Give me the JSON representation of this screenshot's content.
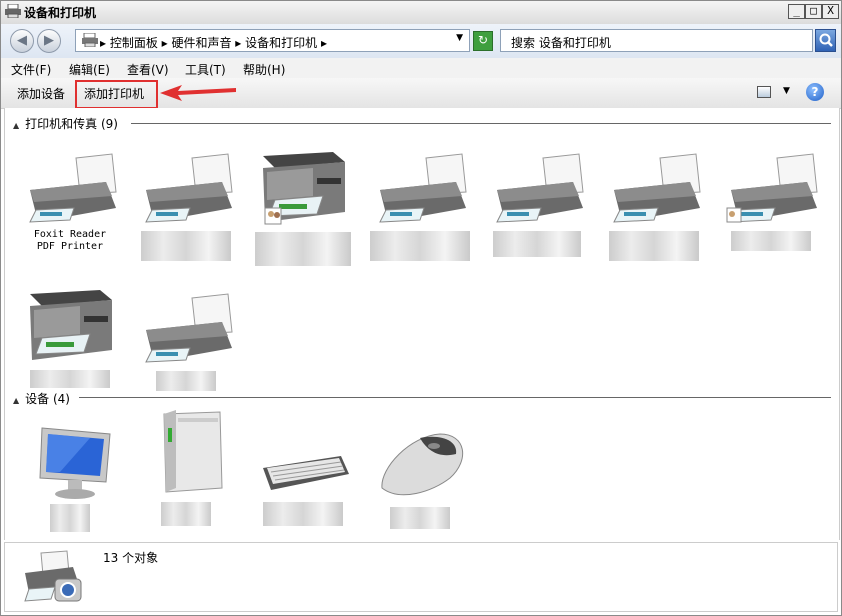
{
  "window": {
    "title": "设备和打印机",
    "minimize": "_",
    "maximize": "□",
    "close": "X"
  },
  "nav": {
    "back_icon": "back-arrow-icon",
    "forward_icon": "forward-arrow-icon"
  },
  "address": {
    "crumbs": [
      "控制面板",
      "硬件和声音",
      "设备和打印机"
    ],
    "text": "▸ 控制面板 ▸ 硬件和声音 ▸ 设备和打印机 ▸"
  },
  "search": {
    "placeholder": "搜索 设备和打印机"
  },
  "menu": {
    "file": "文件(F)",
    "edit": "编辑(E)",
    "view": "查看(V)",
    "tools": "工具(T)",
    "help": "帮助(H)"
  },
  "commands": {
    "add_device": "添加设备",
    "add_printer": "添加打印机"
  },
  "groups": {
    "printers": {
      "title": "打印机和传真 (9)"
    },
    "devices": {
      "title": "设备 (4)"
    }
  },
  "printers": [
    {
      "label1": "Foxit Reader",
      "label2": "PDF Printer",
      "icon": "printer-icon"
    },
    {
      "icon": "printer-icon"
    },
    {
      "icon": "mfp-printer-icon"
    },
    {
      "icon": "printer-icon"
    },
    {
      "icon": "printer-icon"
    },
    {
      "icon": "printer-icon"
    },
    {
      "icon": "printer-icon"
    },
    {
      "icon": "mfp-printer-icon"
    },
    {
      "icon": "printer-icon"
    }
  ],
  "devices": [
    {
      "icon": "monitor-icon"
    },
    {
      "icon": "pc-tower-icon"
    },
    {
      "icon": "keyboard-icon"
    },
    {
      "icon": "mouse-icon"
    }
  ],
  "status": {
    "text": "13 个对象"
  },
  "colors": {
    "highlight": "#e03030",
    "accent": "#1e5fc7"
  }
}
